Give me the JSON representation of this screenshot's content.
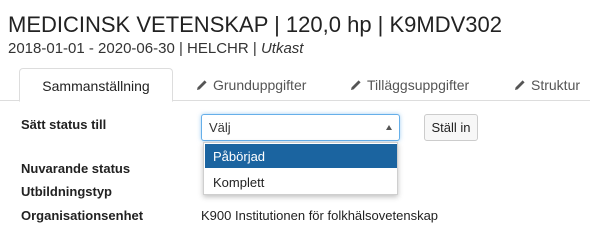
{
  "header": {
    "title": "MEDICINSK VETENSKAP | 120,0 hp | K9MDV302",
    "subtitle": "2018-01-01 - 2020-06-30 | HELCHR |",
    "status": "Utkast"
  },
  "tabs": [
    {
      "label": "Sammanställning",
      "active": true
    },
    {
      "label": "Grunduppgifter",
      "icon": "pencil-icon"
    },
    {
      "label": "Tilläggsuppgifter",
      "icon": "pencil-icon"
    },
    {
      "label": "Struktur",
      "icon": "pencil-icon"
    }
  ],
  "form": {
    "set_status_label": "Sätt status till",
    "select_value": "Välj",
    "apply_button": "Ställ in",
    "options": [
      {
        "label": "Påbörjad",
        "highlighted": true
      },
      {
        "label": "Komplett",
        "highlighted": false
      }
    ]
  },
  "details": {
    "current_status_label": "Nuvarande status",
    "education_type_label": "Utbildningstyp",
    "org_unit_label": "Organisationsenhet",
    "org_unit_value": "K900 Institutionen för folkhälsovetenskap"
  },
  "colors": {
    "highlight": "#1b64a0",
    "focus_border": "#66afe9"
  }
}
